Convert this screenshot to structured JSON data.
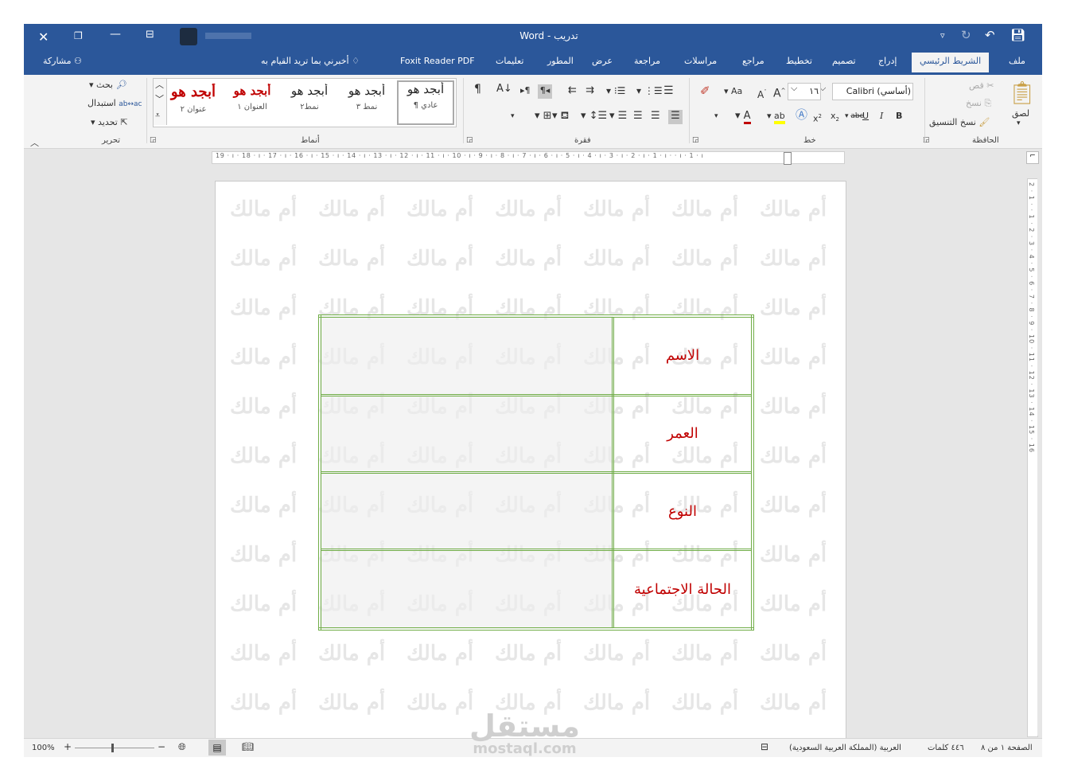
{
  "titlebar": {
    "doc_name": "تدريب",
    "sep": "-",
    "app_name": "Word"
  },
  "tabs": [
    "ملف",
    "الشريط الرئيسي",
    "إدراج",
    "تصميم",
    "تخطيط",
    "مراجع",
    "مراسلات",
    "مراجعة",
    "عرض",
    "المطور",
    "تعليمات",
    "Foxit Reader PDF"
  ],
  "tell_me": "أخبرني بما تريد القيام به",
  "share": "مشاركة",
  "clipboard": {
    "paste": "لصق",
    "cut": "قص",
    "copy": "نسخ",
    "format_painter": "نسخ التنسيق",
    "label": "الحافظة"
  },
  "font": {
    "name": "Calibri (أساسي)",
    "size": "١٦",
    "change_case": "Aa",
    "label": "خط"
  },
  "paragraph": {
    "label": "فقرة"
  },
  "styles": {
    "items": [
      {
        "preview": "أبجد هو",
        "name": "¶ عادي"
      },
      {
        "preview": "أبجد هو",
        "name": "نمط ٣"
      },
      {
        "preview": "أبجد هو",
        "name": "نمط٢"
      },
      {
        "preview": "أبجد هو",
        "name": "العنوان ١"
      },
      {
        "preview": "أبجد هو",
        "name": "عنوان ٢"
      }
    ],
    "label": "أنماط"
  },
  "editing": {
    "find": "بحث",
    "replace": "استبدال",
    "select": "تحديد",
    "label": "تحرير"
  },
  "ruler": {
    "labels": "19 · ı · 18 · ı · 17 · ı · 16 · ı · 15 · ı · 14 · ı · 13 · ı · 12 · ı · 11 · ı · 10 · ı · 9 · ı · 8 · ı · 7 · ı · 6 · ı · 5 · ı · 4 · ı · 3 · ı · 2 · ı · 1 · ı · · ı · 1 · ı"
  },
  "vruler": {
    "labels": "2 · 1 · · 1 · 2 · 3 · 4 · 5 · 6 · 7 · 8 · 9 · 10 · 11 · 12 · 13 · 14 · 15 · 16"
  },
  "watermark": "أم مالك",
  "table": {
    "rows": [
      {
        "label": "الاسم",
        "value": ""
      },
      {
        "label": "العمر",
        "value": ""
      },
      {
        "label": "النوع",
        "value": ""
      },
      {
        "label": "الحالة الاجتماعية",
        "value": ""
      }
    ]
  },
  "status": {
    "page": "الصفحة ١ من ٨",
    "words": "٤٤٦ كلمات",
    "language": "العربية (المملكة العربية السعودية)",
    "zoom": "100%",
    "zoom_minus": "−",
    "zoom_plus": "+"
  },
  "logo": {
    "arabic": "مستقل",
    "latin": "mostaql.com"
  },
  "colors": {
    "accent": "#2b579a",
    "table_border": "#70ad47",
    "label_red": "#c00000",
    "style_red": "#c00000"
  }
}
